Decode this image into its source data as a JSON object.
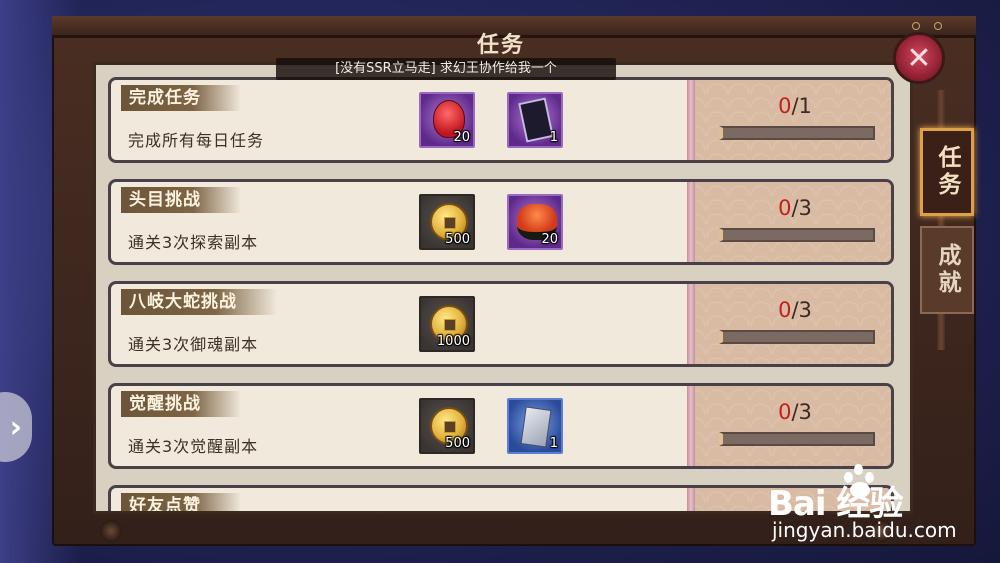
{
  "window": {
    "title": "任务",
    "broadcast": "[没有SSR立马走] 求幻王协作给我一个"
  },
  "close_button": {
    "label": "✕"
  },
  "side_tabs": [
    {
      "label": "任务",
      "active": true
    },
    {
      "label": "成就",
      "active": false
    }
  ],
  "side_handle": {
    "label": "›"
  },
  "tasks": [
    {
      "title": "完成任务",
      "desc": "完成所有每日任务",
      "rewards": [
        {
          "icon": "red-mask-icon",
          "count": "20"
        },
        {
          "icon": "scroll-icon",
          "count": "1"
        }
      ],
      "progress": {
        "current": "0",
        "total": "/1",
        "fraction": 0
      }
    },
    {
      "title": "头目挑战",
      "desc": "通关3次探索副本",
      "rewards": [
        {
          "icon": "gold-coin-icon",
          "count": "500"
        },
        {
          "icon": "sushi-icon",
          "count": "20"
        }
      ],
      "progress": {
        "current": "0",
        "total": "/3",
        "fraction": 0
      }
    },
    {
      "title": "八岐大蛇挑战",
      "desc": "通关3次御魂副本",
      "rewards": [
        {
          "icon": "gold-coin-icon",
          "count": "1000"
        }
      ],
      "progress": {
        "current": "0",
        "total": "/3",
        "fraction": 0
      }
    },
    {
      "title": "觉醒挑战",
      "desc": "通关3次觉醒副本",
      "rewards": [
        {
          "icon": "gold-coin-icon",
          "count": "500"
        },
        {
          "icon": "silver-ticket-icon",
          "count": "1"
        }
      ],
      "progress": {
        "current": "0",
        "total": "/3",
        "fraction": 0
      }
    },
    {
      "title": "好友点赞",
      "desc": "",
      "rewards": [],
      "progress": {
        "current": "",
        "total": "",
        "fraction": 0
      }
    }
  ],
  "watermark": {
    "logo": "Bai  经验",
    "url": "jingyan.baidu.com"
  },
  "colors": {
    "progress_current": "#c2211b",
    "panel": "#d8d0c1",
    "frame": "#3b251b",
    "close_button": "#b02a40"
  }
}
